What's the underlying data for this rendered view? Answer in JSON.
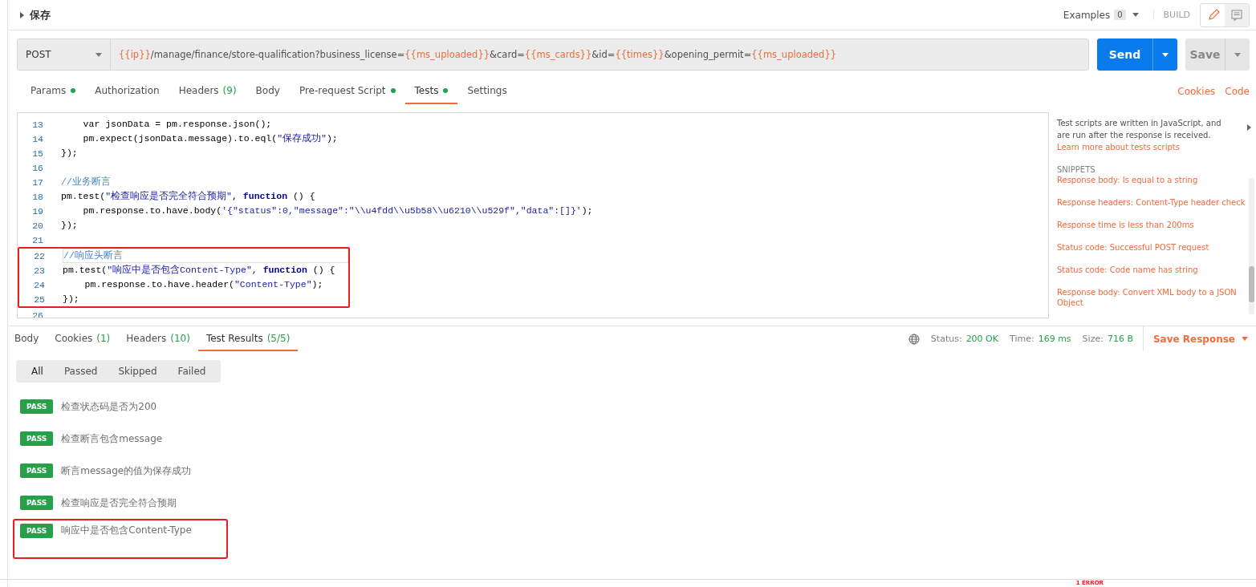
{
  "title": "保存",
  "examples": {
    "label": "Examples",
    "count": "0"
  },
  "build": "BUILD",
  "request": {
    "method": "POST",
    "url_parts": [
      {
        "kind": "variable",
        "text": "{{ip}}"
      },
      {
        "kind": "plain",
        "text": "/manage/finance/store-qualification?business_license="
      },
      {
        "kind": "variable",
        "text": "{{ms_uploaded}}"
      },
      {
        "kind": "plain",
        "text": "&card="
      },
      {
        "kind": "variable",
        "text": "{{ms_cards}}"
      },
      {
        "kind": "plain",
        "text": "&id="
      },
      {
        "kind": "variable",
        "text": "{{times}}"
      },
      {
        "kind": "plain",
        "text": "&opening_permit="
      },
      {
        "kind": "variable",
        "text": "{{ms_uploaded}}"
      }
    ],
    "send": "Send",
    "save": "Save"
  },
  "request_tabs": [
    {
      "label": "Params",
      "dot": true,
      "selected": false
    },
    {
      "label": "Authorization",
      "dot": false,
      "selected": false
    },
    {
      "label": "Headers",
      "count": "(9)",
      "dot": false,
      "selected": false
    },
    {
      "label": "Body",
      "dot": false,
      "selected": false
    },
    {
      "label": "Pre-request Script",
      "dot": true,
      "selected": false
    },
    {
      "label": "Tests",
      "dot": true,
      "selected": true
    },
    {
      "label": "Settings",
      "dot": false,
      "selected": false
    }
  ],
  "links": [
    "Cookies",
    "Code"
  ],
  "editor": {
    "lines": [
      {
        "number": "13",
        "active": false,
        "highlighted": false,
        "tokens": [
          {
            "kind": "plain",
            "text": "    var jsonData = pm.response.json();"
          }
        ]
      },
      {
        "number": "14",
        "active": false,
        "highlighted": false,
        "tokens": [
          {
            "kind": "plain",
            "text": "    pm.expect(jsonData.message).to.eql("
          },
          {
            "kind": "string",
            "text": "\"保存成功\""
          },
          {
            "kind": "plain",
            "text": ");"
          }
        ]
      },
      {
        "number": "15",
        "active": false,
        "highlighted": false,
        "tokens": [
          {
            "kind": "plain",
            "text": "});"
          }
        ]
      },
      {
        "number": "16",
        "active": false,
        "highlighted": false
      },
      {
        "number": "17",
        "active": false,
        "highlighted": false,
        "tokens": [
          {
            "kind": "comment",
            "text": "//业务断言"
          }
        ]
      },
      {
        "number": "18",
        "active": false,
        "highlighted": false,
        "tokens": [
          {
            "kind": "plain",
            "text": "pm.test("
          },
          {
            "kind": "string",
            "text": "\"检查响应是否完全符合预期\""
          },
          {
            "kind": "plain",
            "text": ", "
          },
          {
            "kind": "keyword",
            "text": "function"
          },
          {
            "kind": "plain",
            "text": " () {"
          }
        ]
      },
      {
        "number": "19",
        "active": false,
        "highlighted": false,
        "tokens": [
          {
            "kind": "plain",
            "text": "    pm.response.to.have.body("
          },
          {
            "kind": "string",
            "text": "'{\"status\":0,\"message\":\"\\\\u4fdd\\\\u5b58\\\\u6210\\\\u529f\",\"data\":[]}'"
          },
          {
            "kind": "plain",
            "text": ");"
          }
        ]
      },
      {
        "number": "20",
        "active": false,
        "highlighted": false,
        "tokens": [
          {
            "kind": "plain",
            "text": "});"
          }
        ]
      },
      {
        "number": "21",
        "active": false,
        "highlighted": false
      },
      {
        "number": "22",
        "active": true,
        "highlighted": true,
        "tokens": [
          {
            "kind": "comment",
            "text": "//响应头断言"
          }
        ]
      },
      {
        "number": "23",
        "active": false,
        "highlighted": true,
        "tokens": [
          {
            "kind": "plain",
            "text": "pm.test("
          },
          {
            "kind": "string",
            "text": "\"响应中是否包含Content-Type\""
          },
          {
            "kind": "plain",
            "text": ", "
          },
          {
            "kind": "keyword",
            "text": "function"
          },
          {
            "kind": "plain",
            "text": " () {"
          }
        ]
      },
      {
        "number": "24",
        "active": false,
        "highlighted": true,
        "tokens": [
          {
            "kind": "plain",
            "text": "    pm.response.to.have.header("
          },
          {
            "kind": "string",
            "text": "\"Content-Type\""
          },
          {
            "kind": "plain",
            "text": ");"
          }
        ]
      },
      {
        "number": "25",
        "active": false,
        "highlighted": true,
        "tokens": [
          {
            "kind": "plain",
            "text": "});"
          }
        ]
      },
      {
        "number": "26",
        "active": false,
        "highlighted": false
      }
    ]
  },
  "side": {
    "description": "Test scripts are written in JavaScript, and are run after the response is received.",
    "link": "Learn more about tests scripts",
    "snippets_title": "SNIPPETS",
    "snippets": [
      "Response body: Is equal to a string",
      "Response headers: Content-Type header check",
      "Response time is less than 200ms",
      "Status code: Successful POST request",
      "Status code: Code name has string",
      "Response body: Convert XML body to a JSON Object"
    ]
  },
  "response": {
    "tabs": [
      {
        "label": "Body",
        "selected": false
      },
      {
        "label": "Cookies",
        "count": "(1)",
        "selected": false
      },
      {
        "label": "Headers",
        "count": "(10)",
        "selected": false
      },
      {
        "label": "Test Results",
        "count": "(5/5)",
        "selected": true
      }
    ],
    "stats": [
      {
        "label": "Status:",
        "value": "200 OK"
      },
      {
        "label": "Time:",
        "value": "169 ms"
      },
      {
        "label": "Size:",
        "value": "716 B"
      }
    ],
    "save_response": "Save Response"
  },
  "filters": [
    {
      "label": "All",
      "selected": true
    },
    {
      "label": "Passed",
      "selected": false
    },
    {
      "label": "Skipped",
      "selected": false
    },
    {
      "label": "Failed",
      "selected": false
    }
  ],
  "results": [
    {
      "status": "PASS",
      "name": "检查状态码是否为200",
      "highlighted": false
    },
    {
      "status": "PASS",
      "name": "检查断言包含message",
      "highlighted": false
    },
    {
      "status": "PASS",
      "name": "断言message的值为保存成功",
      "highlighted": false
    },
    {
      "status": "PASS",
      "name": "检查响应是否完全符合预期",
      "highlighted": false
    },
    {
      "status": "PASS",
      "name": "响应中是否包含Content-Type",
      "highlighted": true
    }
  ],
  "footer": {
    "error": "1 ERROR"
  }
}
